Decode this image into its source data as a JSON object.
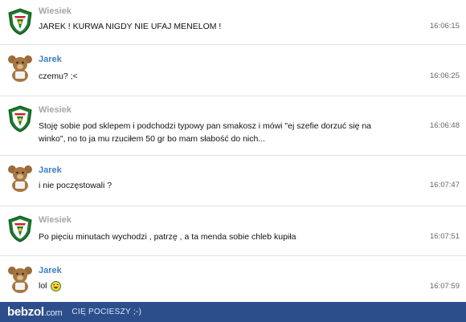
{
  "messages": [
    {
      "sender": "Wiesiek",
      "avatar": "wks-slask-crest-icon",
      "lines": [
        "JAREK ! KURWA NIGDY NIE UFAJ MENELOM !"
      ],
      "time": "16:06:15"
    },
    {
      "sender": "Jarek",
      "avatar": "teddy-bear-icon",
      "lines": [
        "czemu? ;<"
      ],
      "time": "16:06:25"
    },
    {
      "sender": "Wiesiek",
      "avatar": "wks-slask-crest-icon",
      "lines": [
        "Stoję sobie pod sklepem i podchodzi typowy pan smakosz i mówi \"ej szefie dorzuć się na",
        "winko\", no to ja mu rzuciłem 50 gr bo mam słabość do nich..."
      ],
      "time": "16:06:48"
    },
    {
      "sender": "Jarek",
      "avatar": "teddy-bear-icon",
      "lines": [
        "i nie poczęstowali ?"
      ],
      "time": "16:07:47"
    },
    {
      "sender": "Wiesiek",
      "avatar": "wks-slask-crest-icon",
      "lines": [
        "Po pięciu minutach wychodzi , patrzę , a ta menda sobie chleb kupiła"
      ],
      "time": "16:07:51"
    },
    {
      "sender": "Jarek",
      "avatar": "teddy-bear-icon",
      "lines": [
        "lol"
      ],
      "time": "16:07:59",
      "emoticon": "laughing-smiley-icon"
    }
  ],
  "footer": {
    "brand": "bebzol",
    "brand_suffix": ".com",
    "tagline": "CIĘ POCIESZY ;-)"
  },
  "colors": {
    "wiesiek_name": "#a6a6a6",
    "jarek_name": "#3a7fc9",
    "footer_bg": "#2c4f8c"
  }
}
